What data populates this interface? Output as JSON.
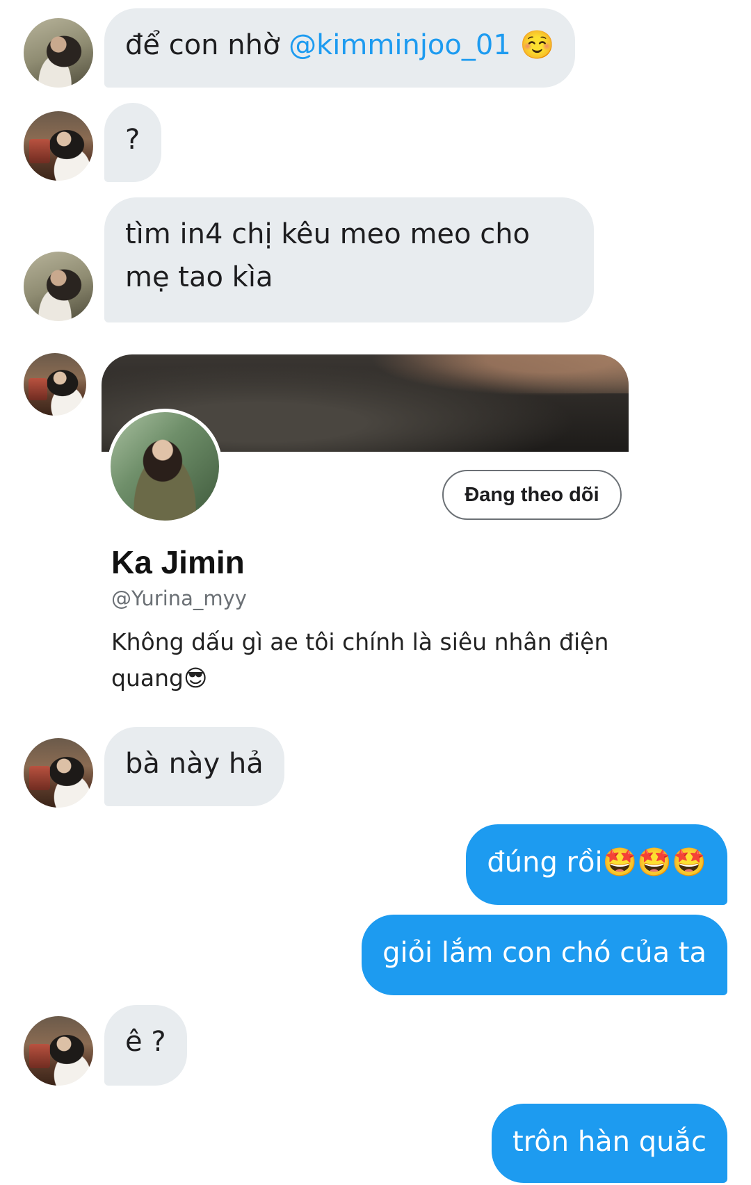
{
  "messages": [
    {
      "side": "in",
      "parts": [
        "để con nhờ ",
        "@kimminjoo_01",
        " ☺️"
      ]
    },
    {
      "side": "in",
      "text": "?"
    },
    {
      "side": "in",
      "text": "tìm in4 chị kêu meo meo cho mẹ tao kìa"
    },
    {
      "side": "in",
      "text": "bà này hả"
    },
    {
      "side": "out",
      "text": "đúng rồi🤩🤩🤩"
    },
    {
      "side": "out",
      "text": "giỏi lắm con chó của ta"
    },
    {
      "side": "in",
      "text": "ê ?"
    },
    {
      "side": "out",
      "text": "trôn hàn quắc"
    }
  ],
  "profile_card": {
    "display_name": "Ka Jimin",
    "handle": "@Yurina_myy",
    "bio": "Không dấu gì ae tôi chính là siêu nhân điện quang😎",
    "follow_button": "Đang theo dõi"
  },
  "colors": {
    "incoming_bubble": "#e8ecef",
    "outgoing_bubble": "#1d9bf0",
    "mention": "#1d9bf0"
  }
}
